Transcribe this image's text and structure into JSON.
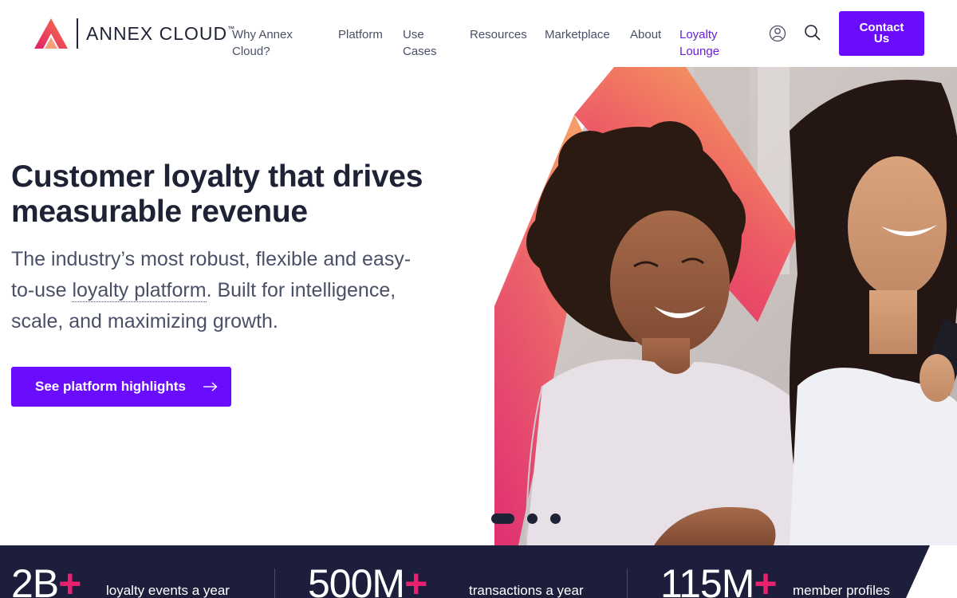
{
  "brand": {
    "name": "ANNEX CLOUD",
    "tm": "™"
  },
  "nav": {
    "items": [
      {
        "label_line1": "Why Annex",
        "label_line2": "Cloud?"
      },
      {
        "label_line1": "Platform",
        "label_line2": ""
      },
      {
        "label_line1": "Use",
        "label_line2": "Cases"
      },
      {
        "label_line1": "Resources",
        "label_line2": ""
      },
      {
        "label_line1": "Marketplace",
        "label_line2": ""
      },
      {
        "label_line1": "About",
        "label_line2": ""
      },
      {
        "label_line1": "Loyalty",
        "label_line2": "Lounge"
      }
    ],
    "contact_line1": "Contact",
    "contact_line2": "Us",
    "account_icon": "user-icon",
    "search_icon": "search-icon"
  },
  "hero": {
    "title_line1": "Customer loyalty that drives",
    "title_line2": "measurable revenue",
    "sub_before": "The industry’s most robust, flexible and easy-to-use ",
    "sub_link": "loyalty platform",
    "sub_after": ". Built for intelligence, scale, and maximizing growth.",
    "cta_label": "See platform highlights",
    "image_alt": "two-women-smiling-at-phone-photo"
  },
  "carousel": {
    "slide_count": 3,
    "active_index": 0
  },
  "stats": [
    {
      "value": "2B",
      "plus": "+",
      "label": "loyalty events a year"
    },
    {
      "value": "500M",
      "plus": "+",
      "label": "transactions a year"
    },
    {
      "value": "115M",
      "plus": "+",
      "label": "member profiles"
    }
  ],
  "colors": {
    "accent": "#6a0dff",
    "active_nav": "#6a1de0",
    "dark_navy": "#1c1e3b",
    "plus_pink": "#e8206e",
    "gradient_orange": "#f47a45",
    "gradient_pink": "#e21f6a"
  }
}
